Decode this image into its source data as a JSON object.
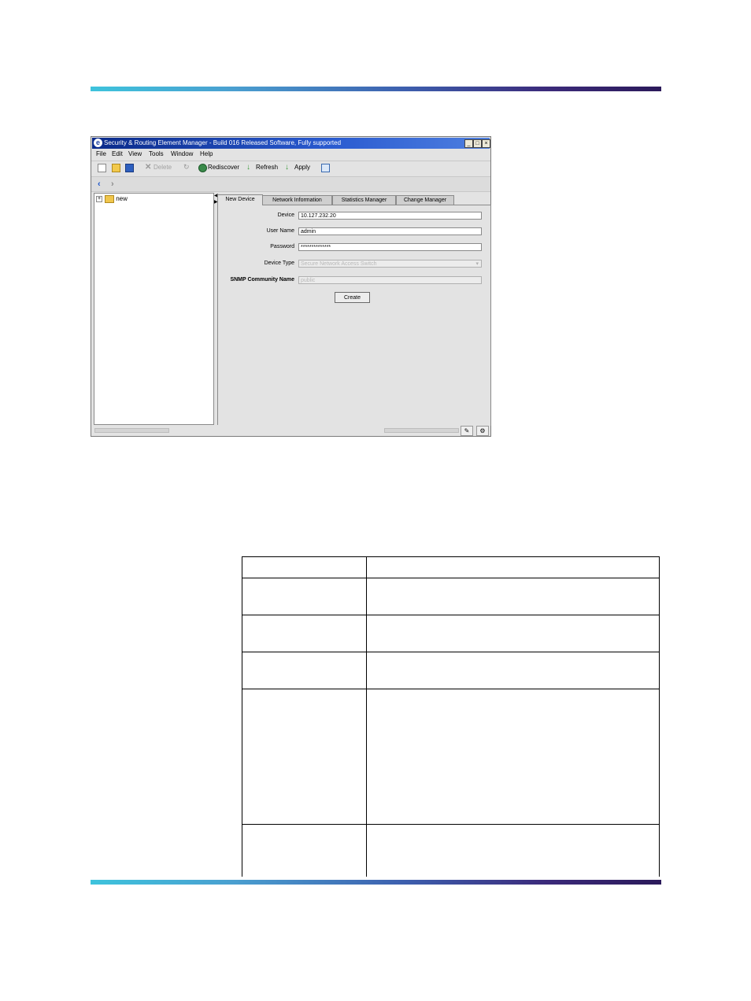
{
  "window": {
    "title": "Security & Routing Element Manager - Build 016 Released Software, Fully supported",
    "controls": [
      "_",
      "□",
      "×"
    ]
  },
  "menu": [
    "File",
    "Edit",
    "View",
    "Tools",
    "Window",
    "Help"
  ],
  "toolbar": {
    "delete_label": "Delete",
    "rediscover_label": "Rediscover",
    "refresh_label": "Refresh",
    "apply_label": "Apply"
  },
  "tree": {
    "expander": "+",
    "root_label": "new"
  },
  "tabs": [
    "New Device",
    "Network Information",
    "Statistics Manager",
    "Change Manager"
  ],
  "form": {
    "device_label": "Device",
    "device_value": "10.127.232.20",
    "username_label": "User Name",
    "username_value": "admin",
    "password_label": "Password",
    "password_value": "**************",
    "device_type_label": "Device Type",
    "device_type_value": "Secure Network Access Switch",
    "snmp_label": "SNMP Community Name",
    "snmp_placeholder": "public",
    "create_label": "Create"
  },
  "colors": {
    "title_bar": "#0a2a8a",
    "accent_rule_start": "#3ec3dc",
    "accent_rule_end": "#2b1a5a"
  }
}
